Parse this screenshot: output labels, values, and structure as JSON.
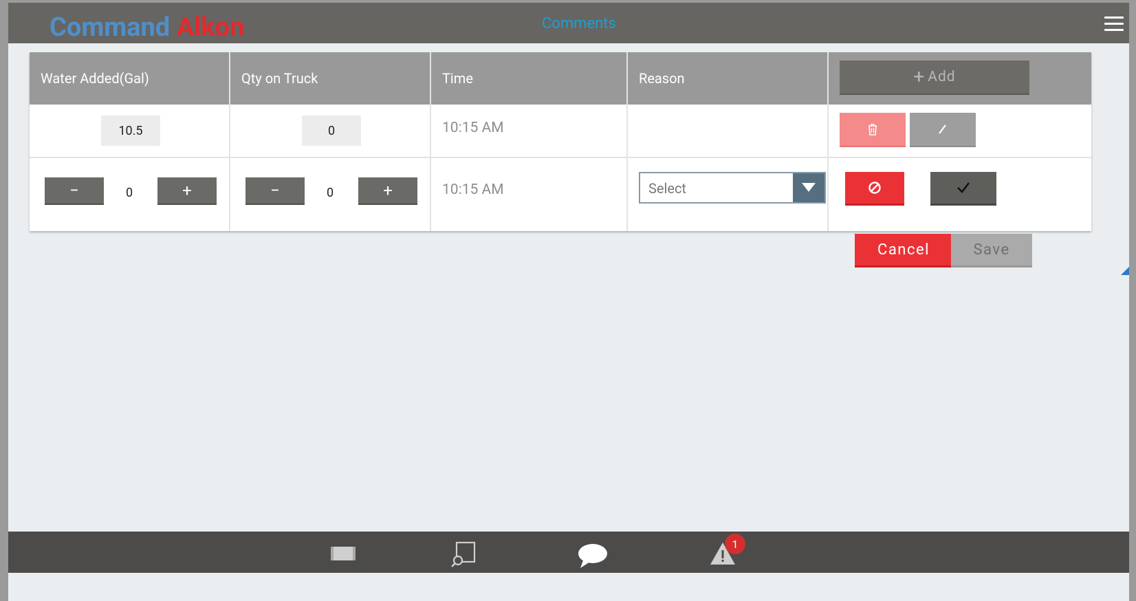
{
  "header": {
    "logo_part1": "Command",
    "logo_part2": "Alkon",
    "title": "Comments"
  },
  "table": {
    "columns": [
      "Water Added(Gal)",
      "Qty on Truck",
      "Time",
      "Reason"
    ],
    "add_label": "Add",
    "saved_row": {
      "water_added": "10.5",
      "qty_on_truck": "0",
      "time": "10:15 AM",
      "reason": ""
    },
    "edit_row": {
      "minus": "−",
      "plus": "+",
      "water_added": "0",
      "qty_on_truck": "0",
      "time": "10:15 AM",
      "reason_placeholder": "Select"
    }
  },
  "actions": {
    "cancel_label": "Cancel",
    "save_label": "Save"
  },
  "bottom_nav": {
    "items": [
      "ticket-icon",
      "map-search-icon",
      "comments-icon",
      "alert-icon"
    ],
    "alert_badge": "1"
  },
  "colors": {
    "topbar": "#666562",
    "accent_red": "#ea3236",
    "accent_blue": "#1aa0d2",
    "background": "#ebeef0"
  }
}
